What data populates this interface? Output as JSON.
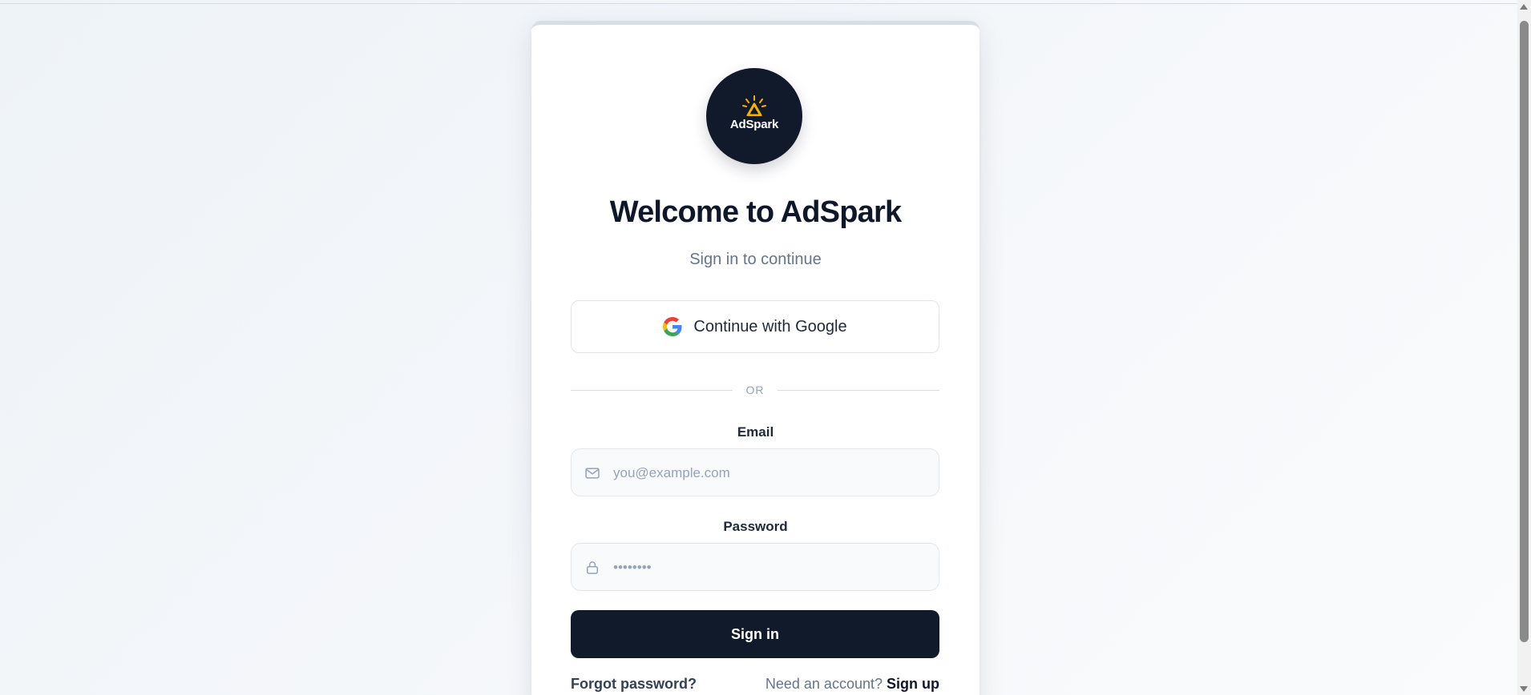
{
  "brand": {
    "logo_text": "AdSpark",
    "logo_icon": "spark-a-icon",
    "accent_color": "#f5b301",
    "dark_color": "#111a2b"
  },
  "header": {
    "title": "Welcome to AdSpark",
    "subtitle": "Sign in to continue"
  },
  "google_button": {
    "label": "Continue with Google",
    "icon": "google-icon"
  },
  "divider": {
    "label": "OR"
  },
  "email": {
    "label": "Email",
    "placeholder": "you@example.com",
    "value": "",
    "icon": "mail-icon"
  },
  "password": {
    "label": "Password",
    "placeholder": "••••••••",
    "value": "",
    "icon": "lock-icon"
  },
  "signin_button": {
    "label": "Sign in"
  },
  "footer": {
    "forgot_label": "Forgot password?",
    "signup_prompt": "Need an account?",
    "signup_label": "Sign up"
  }
}
